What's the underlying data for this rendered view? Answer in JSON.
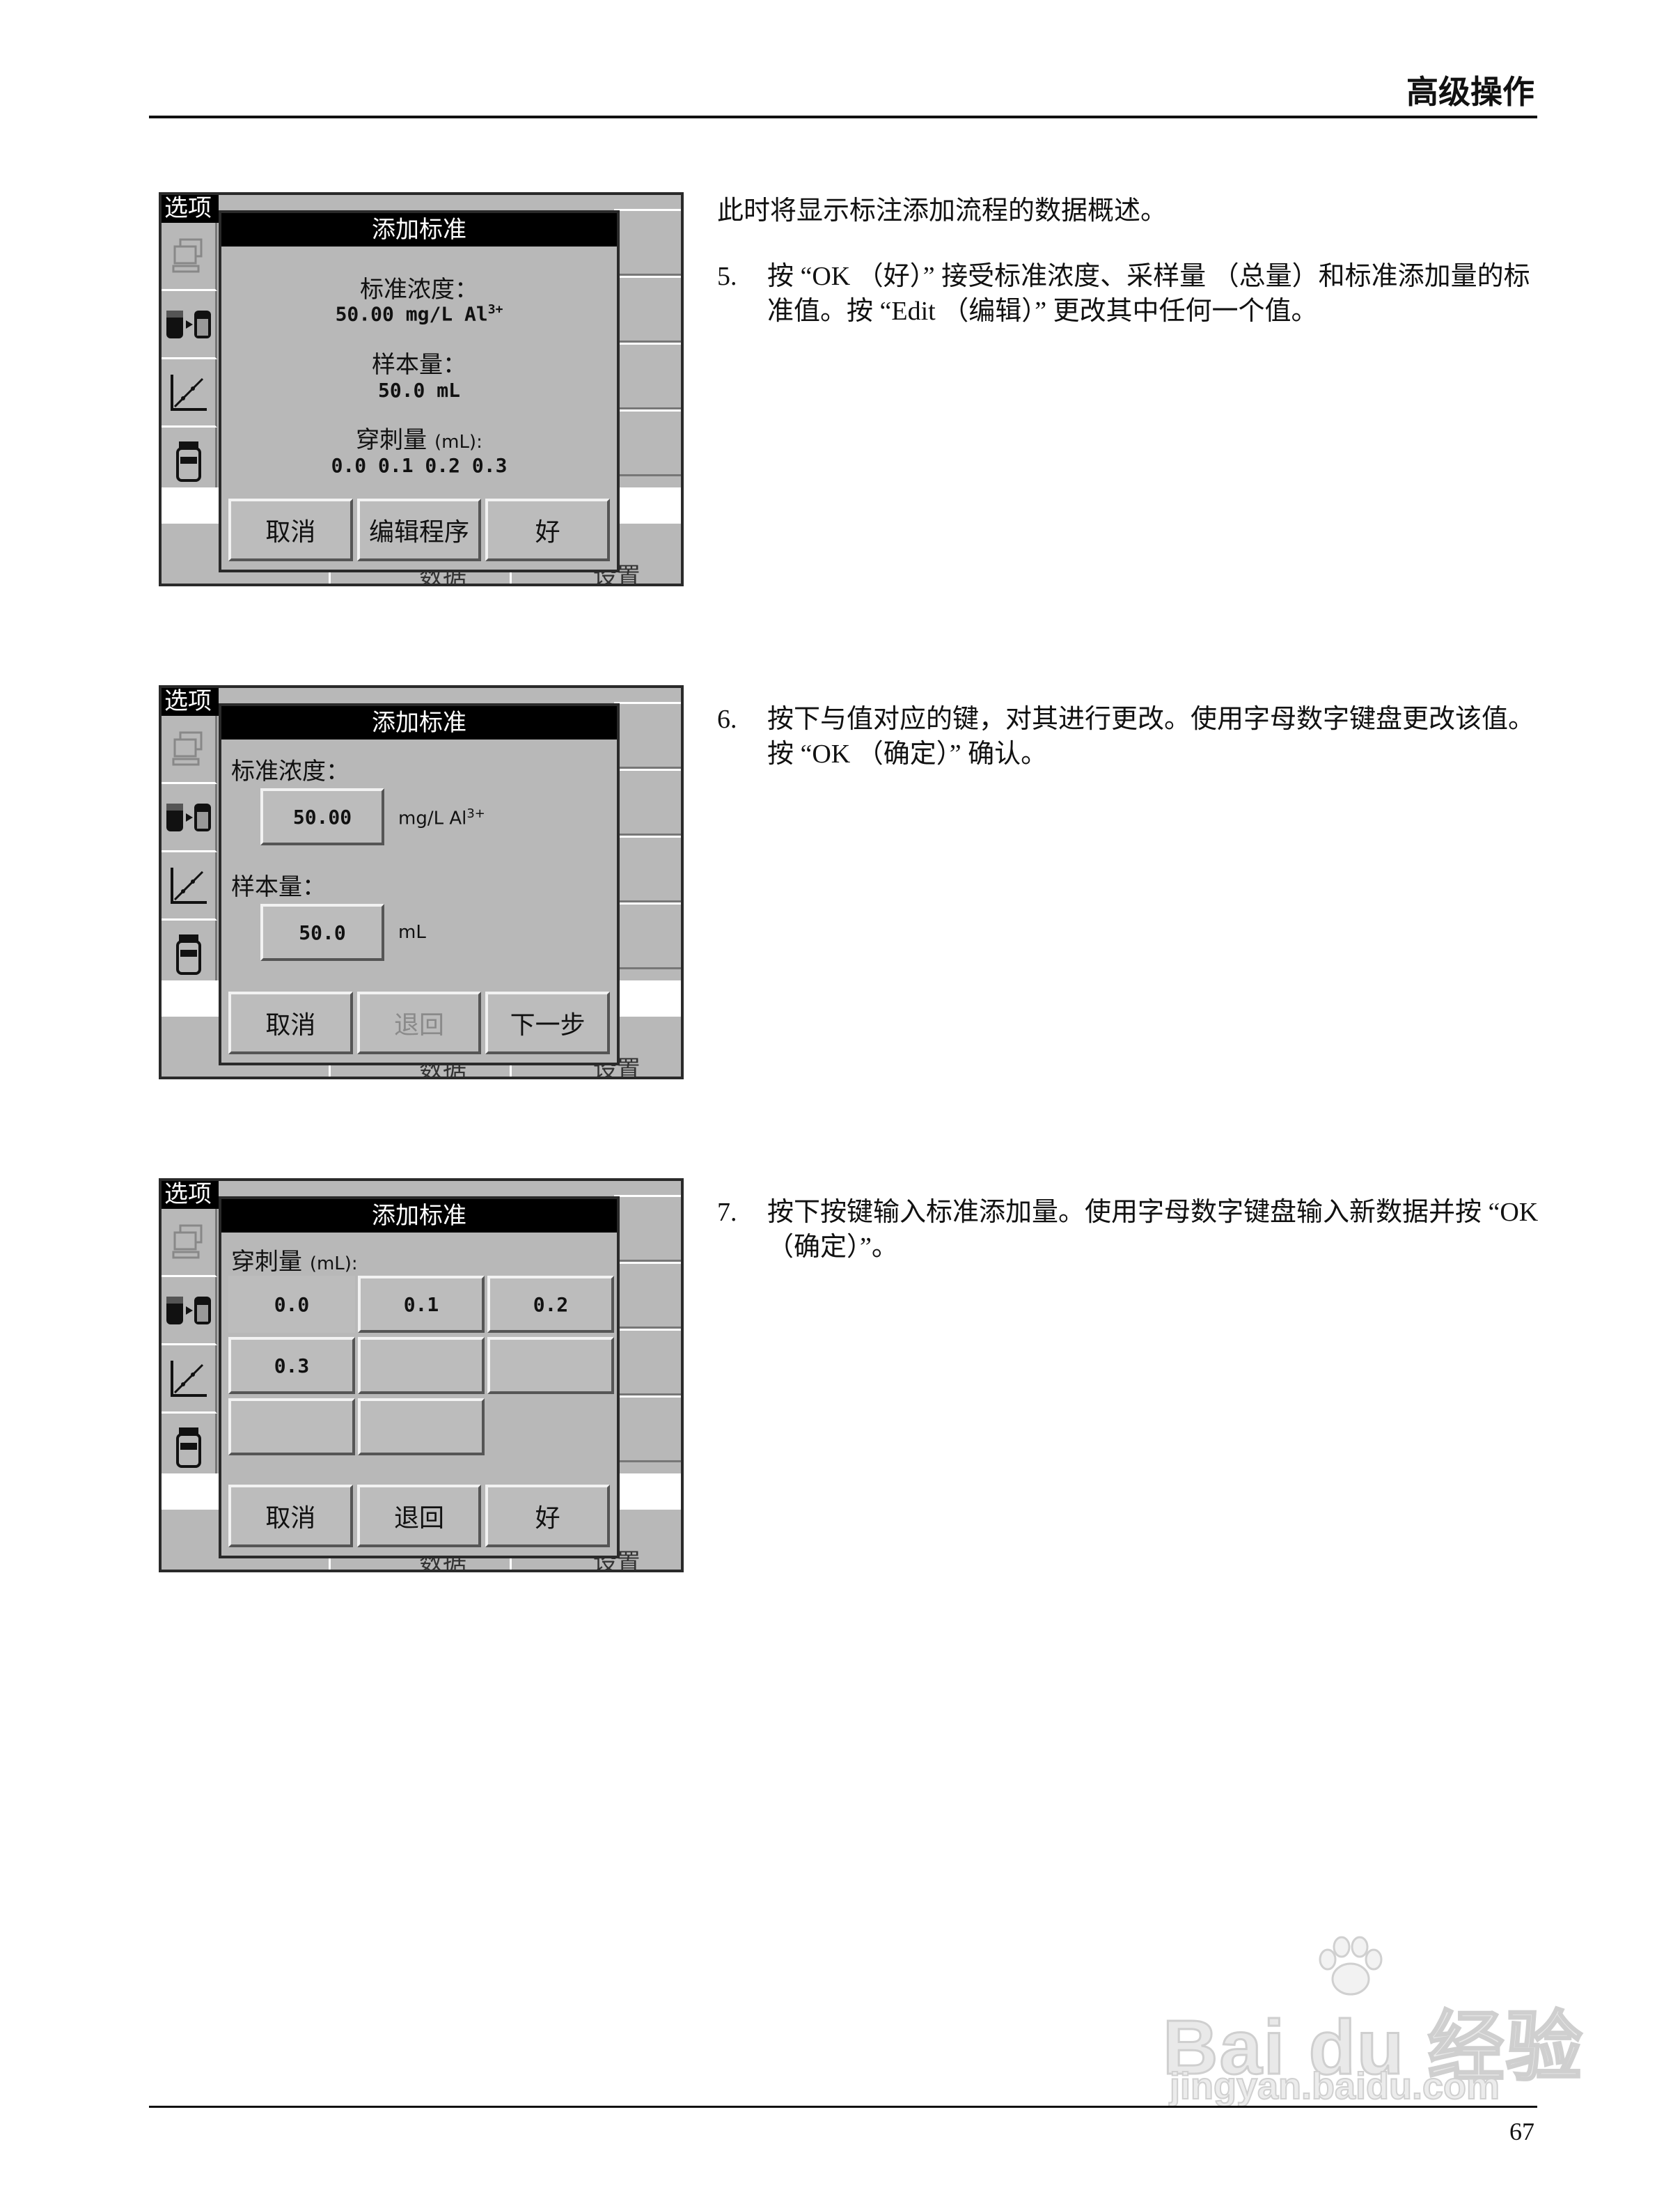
{
  "header": {
    "title": "高级操作"
  },
  "page_number": "67",
  "screens": [
    {
      "options_label": "选项",
      "dialog_title": "添加标准",
      "bg_labels": [
        "数据",
        "设置"
      ],
      "summary": {
        "std_conc_label": "标准浓度：",
        "std_conc_value": "50.00 mg/L Al",
        "std_conc_sup": "3+",
        "sample_vol_label": "样本量：",
        "sample_vol_value": "50.0 mL",
        "spike_label": "穿刺量",
        "spike_unit": "(mL):",
        "spike_values": "0.0 0.1 0.2 0.3"
      },
      "buttons": [
        "取消",
        "编辑程序",
        "好"
      ]
    },
    {
      "options_label": "选项",
      "dialog_title": "添加标准",
      "bg_labels": [
        "数据",
        "设置"
      ],
      "edit": {
        "std_conc_label": "标准浓度：",
        "std_conc_value": "50.00",
        "std_conc_unit": "mg/L Al",
        "std_conc_sup": "3+",
        "sample_vol_label": "样本量：",
        "sample_vol_value": "50.0",
        "sample_vol_unit": "mL"
      },
      "buttons": [
        "取消",
        "退回",
        "下一步"
      ]
    },
    {
      "options_label": "选项",
      "dialog_title": "添加标准",
      "bg_labels": [
        "数据",
        "设置"
      ],
      "spike": {
        "label": "穿刺量",
        "unit": "(mL):",
        "values": [
          "0.0",
          "0.1",
          "0.2",
          "0.3",
          "",
          "",
          "",
          ""
        ]
      },
      "buttons": [
        "取消",
        "退回",
        "好"
      ]
    }
  ],
  "text": {
    "intro": "此时将显示标注添加流程的数据概述。",
    "step5_num": "5.",
    "step5": "按 “OK （好）” 接受标准浓度、采样量 （总量）和标准添加量的标准值。按 “Edit （编辑）” 更改其中任何一个值。",
    "step6_num": "6.",
    "step6": "按下与值对应的键，对其进行更改。使用字母数字键盘更改该值。按 “OK （确定）” 确认。",
    "step7_num": "7.",
    "step7": "按下按键输入标准添加量。使用字母数字键盘输入新数据并按 “OK （确定）”。"
  },
  "watermark": {
    "brand": "Bai du 经验",
    "site": "jingyan.baidu.com"
  },
  "icons": [
    "pc-icon",
    "sample-arrow-icon",
    "calibration-curve-icon",
    "bottle-icon"
  ]
}
